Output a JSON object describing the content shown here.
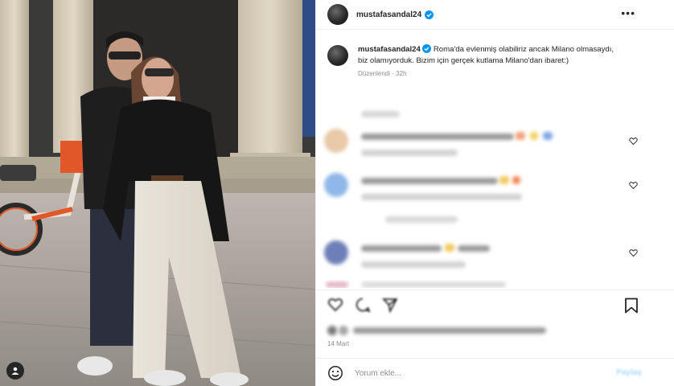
{
  "post": {
    "username": "mustafasandal24",
    "verified_icon": "verified-badge-icon",
    "more_icon": "more-options-icon",
    "more_label": "•••"
  },
  "caption": {
    "username": "mustafasandal24",
    "text": "Roma'da evlenmiş olabiliriz ancak Milano olmasaydı, biz olamıyorduk. Bizim için gerçek kutlama Milano'dan ibaret:)",
    "edited_label": "Düzenlendi",
    "separator": "·",
    "age": "32h"
  },
  "comments": {
    "count_visible": 4,
    "blurred": true
  },
  "actions": {
    "icons": [
      "heart-icon",
      "comment-icon",
      "share-icon"
    ],
    "bookmark_icon": "bookmark-icon"
  },
  "post_date": "14 Mart",
  "comment_box": {
    "placeholder": "Yorum ekle...",
    "post_label": "Paylaş"
  },
  "colors": {
    "accent": "#0095f6",
    "verified": "#0095f6",
    "text": "#262626",
    "muted": "#8e8e8e"
  }
}
